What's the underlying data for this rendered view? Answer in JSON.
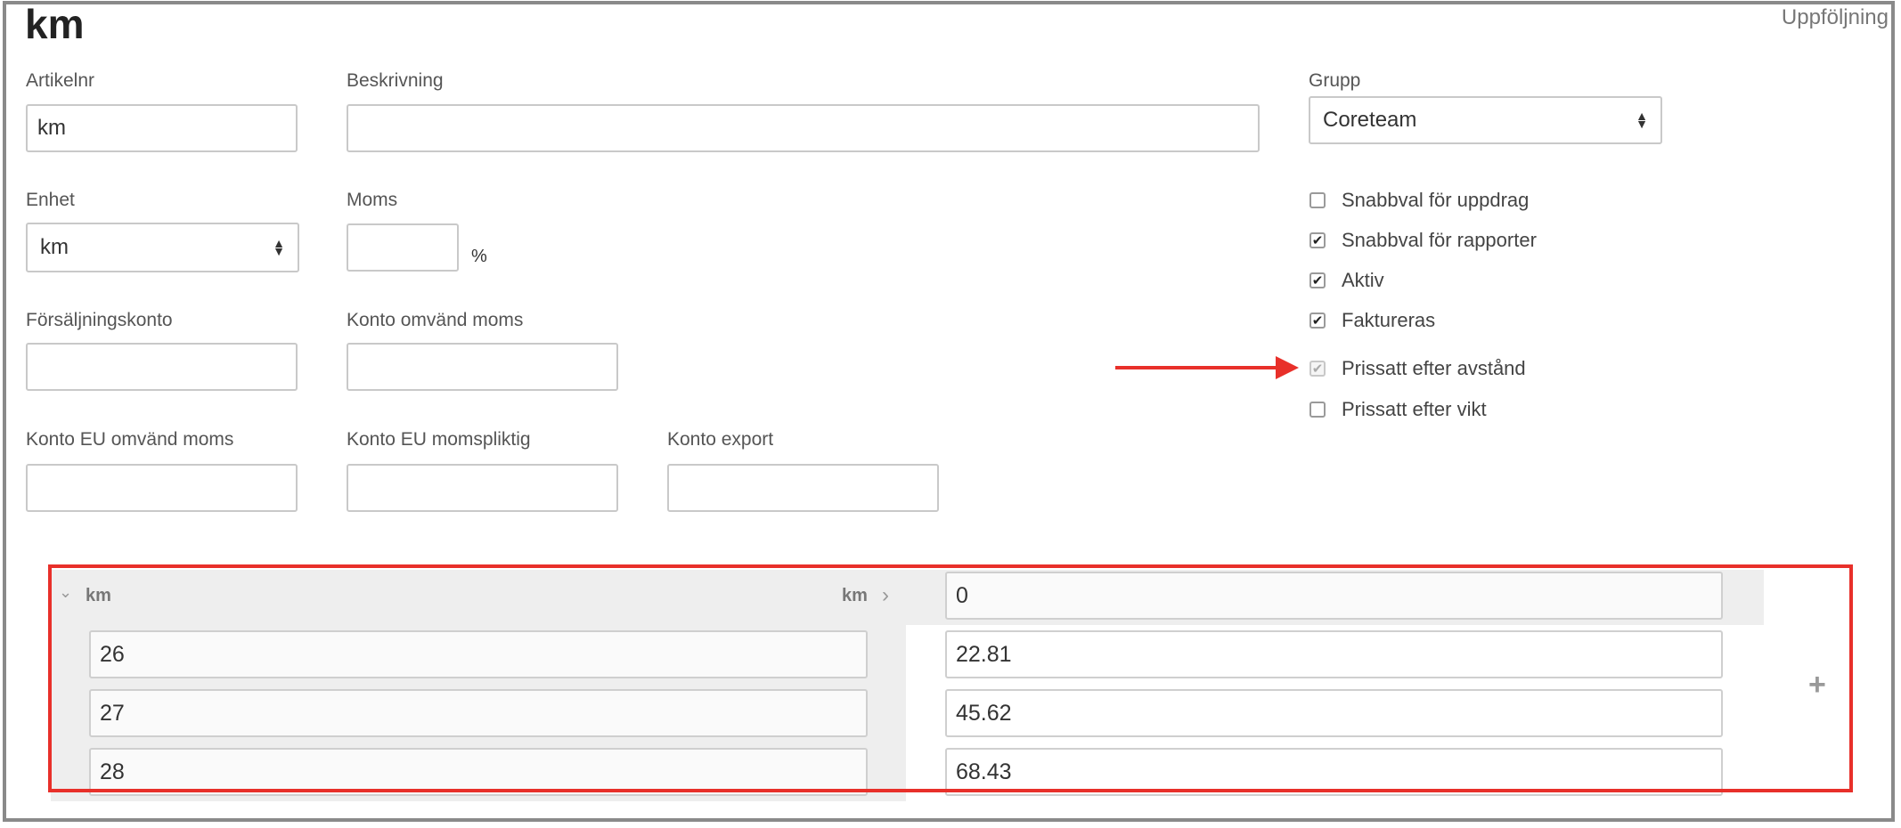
{
  "header": {
    "title": "km",
    "followup_link": "Uppföljning"
  },
  "form": {
    "article_no": {
      "label": "Artikelnr",
      "value": "km"
    },
    "description": {
      "label": "Beskrivning",
      "value": ""
    },
    "group": {
      "label": "Grupp",
      "selected": "Coreteam"
    },
    "unit": {
      "label": "Enhet",
      "selected": "km"
    },
    "vat": {
      "label": "Moms",
      "value": "",
      "suffix": "%"
    },
    "sales_account": {
      "label": "Försäljningskonto",
      "value": ""
    },
    "reverse_vat_account": {
      "label": "Konto omvänd moms",
      "value": ""
    },
    "eu_reverse_vat_account": {
      "label": "Konto EU omvänd moms",
      "value": ""
    },
    "eu_vat_account": {
      "label": "Konto EU momspliktig",
      "value": ""
    },
    "export_account": {
      "label": "Konto export",
      "value": ""
    }
  },
  "checkboxes": [
    {
      "label": "Snabbval för uppdrag",
      "checked": false,
      "disabled": false
    },
    {
      "label": "Snabbval för rapporter",
      "checked": true,
      "disabled": false
    },
    {
      "label": "Aktiv",
      "checked": true,
      "disabled": false
    },
    {
      "label": "Faktureras",
      "checked": true,
      "disabled": false
    },
    {
      "label": "Prissatt efter avstånd",
      "checked": true,
      "disabled": true
    },
    {
      "label": "Prissatt efter vikt",
      "checked": false,
      "disabled": false
    }
  ],
  "price_table": {
    "header_left_unit": "km",
    "header_right_unit": "km",
    "header_price": "0",
    "rows": [
      {
        "distance": "26",
        "price": "22.81"
      },
      {
        "distance": "27",
        "price": "45.62"
      },
      {
        "distance": "28",
        "price": "68.43"
      }
    ],
    "add_symbol": "+"
  },
  "colors": {
    "annotation": "#e8302a",
    "panel_bg": "#eeeeee",
    "border": "#c9c9c9"
  },
  "icons": {
    "select_arrows": "up-down-caret-icon",
    "check": "checkmark-icon",
    "collapse": "chevron-down-icon",
    "expand": "chevron-right-icon",
    "add": "plus-icon",
    "annotation": "red-arrow"
  }
}
